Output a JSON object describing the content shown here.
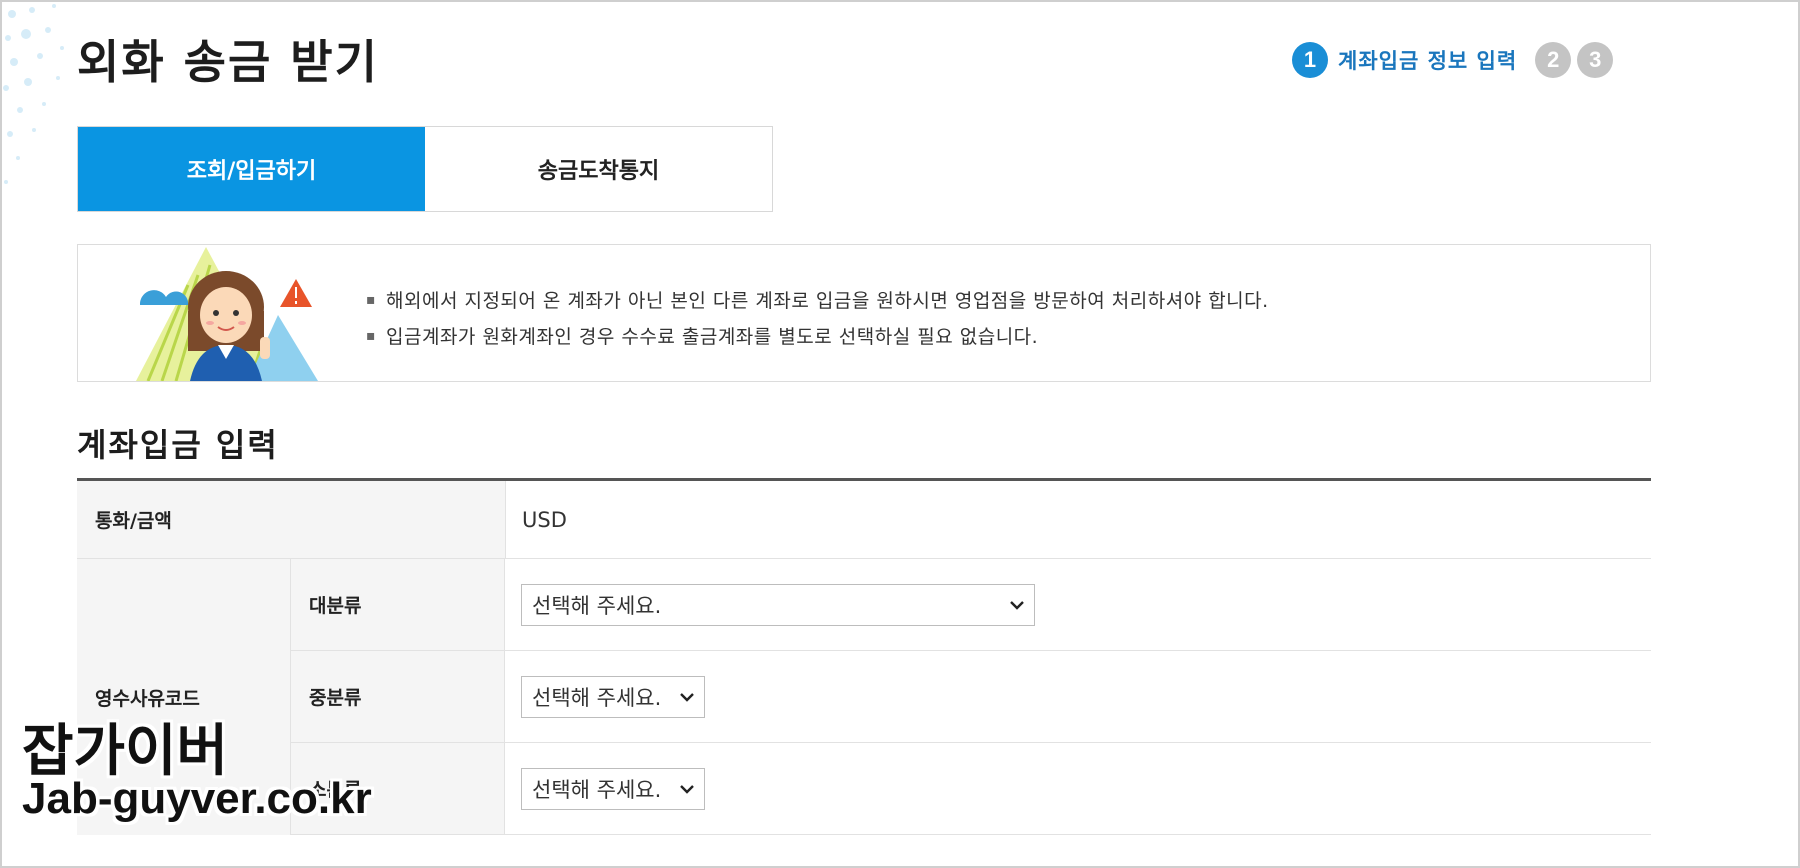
{
  "page": {
    "title": "외화 송금 받기"
  },
  "steps": {
    "current_number": "1",
    "current_label": "계좌입금 정보 입력",
    "next": [
      "2",
      "3"
    ]
  },
  "tabs": [
    {
      "label": "조회/입금하기",
      "active": true
    },
    {
      "label": "송금도착통지",
      "active": false
    }
  ],
  "notice": {
    "lines": [
      "해외에서 지정되어 온 계좌가 아닌 본인 다른 계좌로 입금을 원하시면 영업점을 방문하여 처리하셔야 합니다.",
      "입금계좌가 원화계좌인 경우 수수료 출금계좌를 별도로 선택하실 필요 없습니다."
    ]
  },
  "section": {
    "title": "계좌입금 입력"
  },
  "form": {
    "currency": {
      "label": "통화/금액",
      "value": "USD"
    },
    "receipt_code": {
      "label": "영수사유코드",
      "major": {
        "label": "대분류",
        "selected": "선택해 주세요."
      },
      "middle": {
        "label": "중분류",
        "selected": "선택해 주세요."
      },
      "minor": {
        "label": "소분류",
        "selected": "선택해 주세요."
      }
    }
  },
  "watermark": {
    "line1": "잡가이버",
    "line2": "Jab-guyver.co.kr"
  },
  "colors": {
    "accent": "#0a95e2",
    "step_active": "#1a8ed6",
    "step_inactive": "#c4c4c4"
  }
}
